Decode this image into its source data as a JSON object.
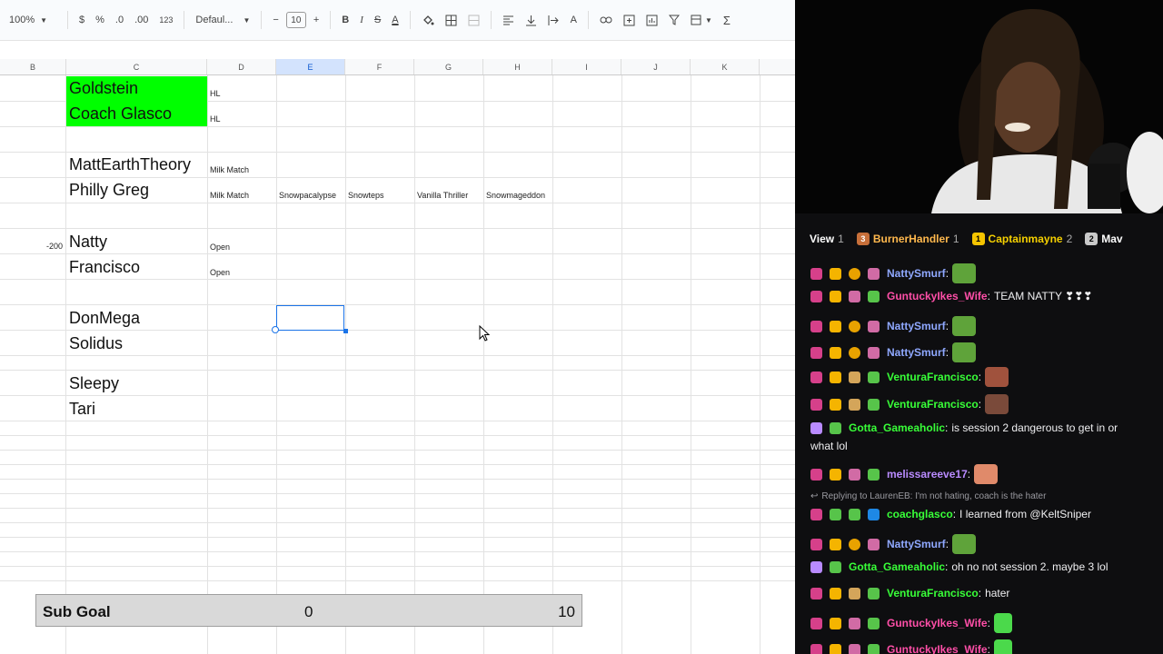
{
  "toolbar": {
    "zoom": "100%",
    "currency": "$",
    "percent": "%",
    "dec_less": ".0",
    "dec_more": ".00",
    "number_format": "123",
    "font": "Defaul...",
    "minus": "−",
    "font_size": "10",
    "plus": "+",
    "bold": "B",
    "italic": "I",
    "strike": "S",
    "text_color": "A",
    "sigma": "Σ"
  },
  "columns": [
    "B",
    "C",
    "D",
    "E",
    "F",
    "G",
    "H",
    "I",
    "J",
    "K"
  ],
  "cells": {
    "c_goldstein": "Goldstein",
    "c_coach": "Coach Glasco",
    "d_hl1": "HL",
    "d_hl2": "HL",
    "c_matt": "MattEarthTheory",
    "c_philly": "Philly Greg",
    "d_milk1": "Milk Match",
    "d_milk2": "Milk Match",
    "e_snow1": "Snowpacalypse",
    "f_snow2": "Snowteps",
    "g_vanilla": "Vanilla Thriller",
    "h_snow3": "Snowmageddon",
    "b_minus": "-200",
    "c_natty": "Natty",
    "c_francisco": "Francisco",
    "d_open1": "Open",
    "d_open2": "Open",
    "c_donmega": "DonMega",
    "c_solidus": "Solidus",
    "c_sleepy": "Sleepy",
    "c_tari": "Tari"
  },
  "subgoal": {
    "label": "Sub Goal",
    "current": "0",
    "target": "10"
  },
  "leaderboard": [
    {
      "name": "View",
      "count": "1",
      "rank": ""
    },
    {
      "name": "BurnerHandler",
      "count": "1",
      "rank": "3"
    },
    {
      "name": "Captainmayne",
      "count": "2",
      "rank": "1"
    },
    {
      "name": "Mav",
      "count": "",
      "rank": "2"
    }
  ],
  "chat": [
    {
      "user": "NattySmurf",
      "text": "",
      "color": "#8fa8ff",
      "emote": "#5fa33a"
    },
    {
      "user": "GuntuckyIkes_Wife",
      "text": "TEAM NATTY ❣❣❣",
      "color": "#ff4fa8",
      "emote": ""
    },
    {
      "user": "NattySmurf",
      "text": "",
      "color": "#8fa8ff",
      "emote": "#5fa33a"
    },
    {
      "user": "NattySmurf",
      "text": "",
      "color": "#8fa8ff",
      "emote": "#5fa33a"
    },
    {
      "user": "VenturaFrancisco",
      "text": "",
      "color": "#38ff38",
      "emote": "#a0523d"
    },
    {
      "user": "VenturaFrancisco",
      "text": "",
      "color": "#38ff38",
      "emote": "#7a4a3a"
    },
    {
      "user": "Gotta_Gameaholic",
      "text": "is session 2 dangerous to get in or",
      "text2": "what lol",
      "color": "#38ff38",
      "emote": ""
    },
    {
      "user": "melissareeve17",
      "text": "",
      "color": "#b98bff",
      "emote": "#e08a6a"
    },
    {
      "reply": "Replying to LaurenEB: I'm not hating, coach is the hater"
    },
    {
      "user": "coachglasco",
      "text": "I learned from @KeltSniper",
      "color": "#38ff38",
      "emote": ""
    },
    {
      "user": "NattySmurf",
      "text": "",
      "color": "#8fa8ff",
      "emote": "#5fa33a"
    },
    {
      "user": "Gotta_Gameaholic",
      "text": "oh no not session 2. maybe 3 lol",
      "color": "#38ff38",
      "emote": ""
    },
    {
      "user": "VenturaFrancisco",
      "text": "hater",
      "color": "#38ff38",
      "emote": ""
    },
    {
      "user": "GuntuckyIkes_Wife",
      "text": "",
      "color": "#ff4fa8",
      "emote": "#4bd94b"
    },
    {
      "user": "GuntuckyIkes_Wife",
      "text": "",
      "color": "#ff4fa8",
      "emote": "#4bd94b"
    }
  ],
  "colors": {
    "highlight": "#00ff00",
    "selection": "#1a73e8",
    "chat_bg": "#0e0e10"
  }
}
